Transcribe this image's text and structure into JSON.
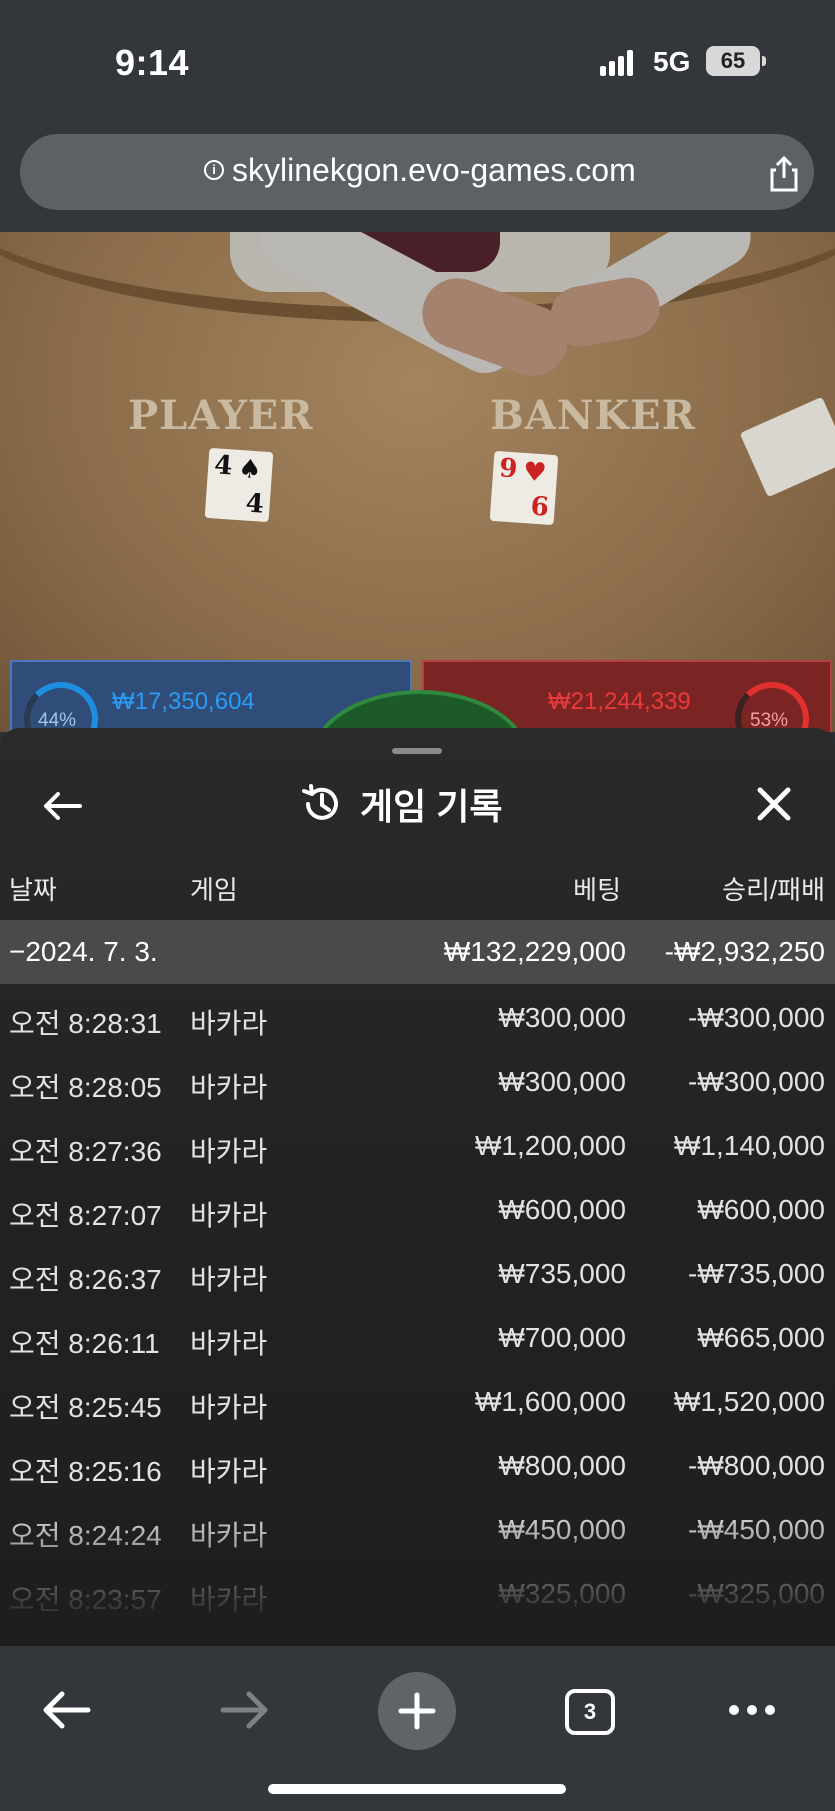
{
  "status_bar": {
    "time": "9:14",
    "network": "5G",
    "battery": "65"
  },
  "browser": {
    "url": "skylinekgon.evo-games.com"
  },
  "table_video": {
    "player_label": "PLAYER",
    "banker_label": "BANKER",
    "player_card": {
      "rank_top": "4",
      "rank_bottom": "4",
      "suit": "♠"
    },
    "banker_card": {
      "rank_top": "9",
      "rank_bottom": "6",
      "suit": "♥"
    },
    "player_percent": "44%",
    "banker_percent": "53%",
    "player_amount": "₩17,350,604",
    "banker_amount": "₩21,244,339"
  },
  "panel": {
    "title": "게임 기록",
    "columns": {
      "date": "날짜",
      "game": "게임",
      "bet": "베팅",
      "winloss": "승리/패배"
    },
    "date_group": {
      "date": "−2024. 7. 3.",
      "bet": "₩132,229,000",
      "winloss": "-₩2,932,250"
    },
    "rows": [
      {
        "time": "오전 8:28:31",
        "game": "바카라",
        "bet": "₩300,000",
        "winloss": "-₩300,000"
      },
      {
        "time": "오전 8:28:05",
        "game": "바카라",
        "bet": "₩300,000",
        "winloss": "-₩300,000"
      },
      {
        "time": "오전 8:27:36",
        "game": "바카라",
        "bet": "₩1,200,000",
        "winloss": "₩1,140,000"
      },
      {
        "time": "오전 8:27:07",
        "game": "바카라",
        "bet": "₩600,000",
        "winloss": "₩600,000"
      },
      {
        "time": "오전 8:26:37",
        "game": "바카라",
        "bet": "₩735,000",
        "winloss": "-₩735,000"
      },
      {
        "time": "오전 8:26:11",
        "game": "바카라",
        "bet": "₩700,000",
        "winloss": "₩665,000"
      },
      {
        "time": "오전 8:25:45",
        "game": "바카라",
        "bet": "₩1,600,000",
        "winloss": "₩1,520,000"
      },
      {
        "time": "오전 8:25:16",
        "game": "바카라",
        "bet": "₩800,000",
        "winloss": "-₩800,000"
      },
      {
        "time": "오전 8:24:24",
        "game": "바카라",
        "bet": "₩450,000",
        "winloss": "-₩450,000"
      },
      {
        "time": "오전 8:23:57",
        "game": "바카라",
        "bet": "₩325,000",
        "winloss": "-₩325,000"
      }
    ]
  },
  "toolbar": {
    "tab_count": "3"
  },
  "colors": {
    "accent_blue": "#2a9cf5",
    "accent_red": "#ea3a3a",
    "panel_bg": "#222222",
    "date_row_bg": "#4a4a4a"
  }
}
